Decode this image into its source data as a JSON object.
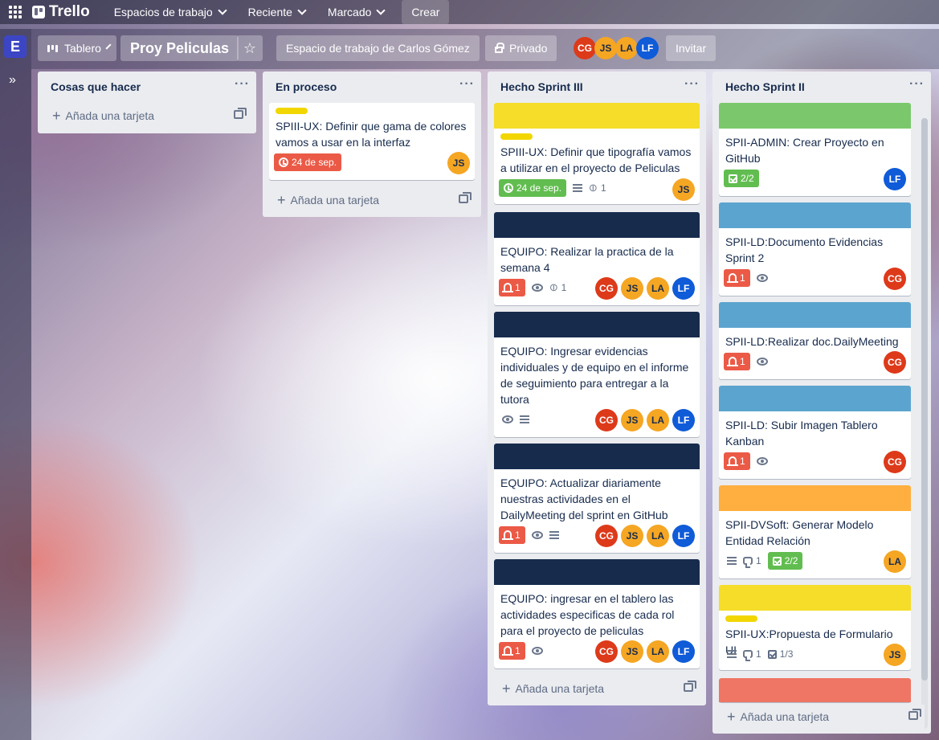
{
  "topbar": {
    "brand": "Trello",
    "workspaces": "Espacios de trabajo",
    "recent": "Reciente",
    "starred": "Marcado",
    "create": "Crear"
  },
  "rail": {
    "workspace_initial": "E",
    "expand": "»"
  },
  "board": {
    "view": "Tablero",
    "title": "Proy Peliculas",
    "workspace": "Espacio de trabajo de Carlos Gómez",
    "visibility": "Privado",
    "invite": "Invitar",
    "members": [
      "CG",
      "JS",
      "LA",
      "LF"
    ]
  },
  "lists": [
    {
      "title": "Cosas que hacer",
      "menu": "···",
      "add_card": "Añada una tarjeta",
      "cards": []
    },
    {
      "title": "En proceso",
      "menu": "···",
      "add_card": "Añada una tarjeta",
      "cards": [
        {
          "title": "SPIII-UX: Definir que gama de colores vamos a usar en la interfaz",
          "due": "24 de sep.",
          "members": [
            "JS"
          ]
        }
      ]
    },
    {
      "title": "Hecho Sprint III",
      "menu": "···",
      "add_card": "Añada una tarjeta",
      "cards": [
        {
          "title": "SPIII-UX: Definir que tipografía vamos a utilizar en el proyecto de Peliculas",
          "due": "24 de sep.",
          "attachments": "1",
          "members": [
            "JS"
          ]
        },
        {
          "title": "EQUIPO: Realizar la practica de la semana 4",
          "notifications": "1",
          "attachments": "1",
          "members": [
            "CG",
            "JS",
            "LA",
            "LF"
          ]
        },
        {
          "title": "EQUIPO: Ingresar evidencias individuales y de equipo en el informe de seguimiento para entregar a la tutora",
          "members": [
            "CG",
            "JS",
            "LA",
            "LF"
          ]
        },
        {
          "title": "EQUIPO: Actualizar diariamente nuestras actividades en el DailyMeeting del sprint en GitHub",
          "notifications": "1",
          "members": [
            "CG",
            "JS",
            "LA",
            "LF"
          ]
        },
        {
          "title": "EQUIPO: ingresar en el tablero las actividades especificas de cada rol para el proyecto de peliculas",
          "notifications": "1",
          "members": [
            "CG",
            "JS",
            "LA",
            "LF"
          ]
        }
      ]
    },
    {
      "title": "Hecho Sprint II",
      "menu": "···",
      "add_card": "Añada una tarjeta",
      "cards": [
        {
          "title": "SPII-ADMIN: Crear Proyecto en GitHub",
          "checklist": "2/2",
          "members": [
            "LF"
          ]
        },
        {
          "title": "SPII-LD:Documento Evidencias Sprint 2",
          "notifications": "1",
          "members": [
            "CG"
          ]
        },
        {
          "title": "SPII-LD:Realizar doc.DailyMeeting",
          "notifications": "1",
          "members": [
            "CG"
          ]
        },
        {
          "title": "SPII-LD: Subir Imagen Tablero Kanban",
          "notifications": "1",
          "members": [
            "CG"
          ]
        },
        {
          "title": "SPII-DVSoft: Generar Modelo Entidad Relación",
          "comments": "1",
          "checklist": "2/2",
          "members": [
            "LA"
          ]
        },
        {
          "title": "SPII-UX:Propuesta de Formulario UI",
          "comments": "1",
          "checklist": "1/3",
          "members": [
            "JS"
          ]
        }
      ]
    }
  ],
  "colors": {
    "label_yellow": "#f2d600",
    "cover_green": "#7bc86c",
    "cover_blue": "#5ba4cf",
    "cover_navy": "#172b4d",
    "cover_orange": "#ffaf3f",
    "cover_yellow": "#f5dd29",
    "cover_red": "#ef7564",
    "badge_red": "#eb5a46",
    "badge_green": "#61bd4f"
  }
}
